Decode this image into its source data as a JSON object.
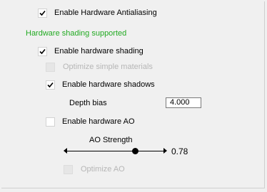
{
  "hardware": {
    "antialiasing": {
      "label": "Enable Hardware Antialiasing",
      "checked": true
    },
    "shading_status": "Hardware shading supported",
    "shading": {
      "label": "Enable hardware shading",
      "checked": true
    },
    "optimize_materials": {
      "label": "Optimize simple materials",
      "checked": false,
      "enabled": false
    },
    "shadows": {
      "label": "Enable hardware shadows",
      "checked": true
    },
    "depth_bias": {
      "label": "Depth bias",
      "value": "4.000"
    },
    "ao": {
      "label": "Enable hardware AO",
      "checked": false
    },
    "ao_strength": {
      "label": "AO Strength",
      "value": 0.78,
      "value_text": "0.78"
    },
    "optimize_ao": {
      "label": "Optimize AO",
      "checked": false,
      "enabled": false
    }
  },
  "colors": {
    "status_green": "#22aa22",
    "disabled_text": "#b6b6b6"
  }
}
